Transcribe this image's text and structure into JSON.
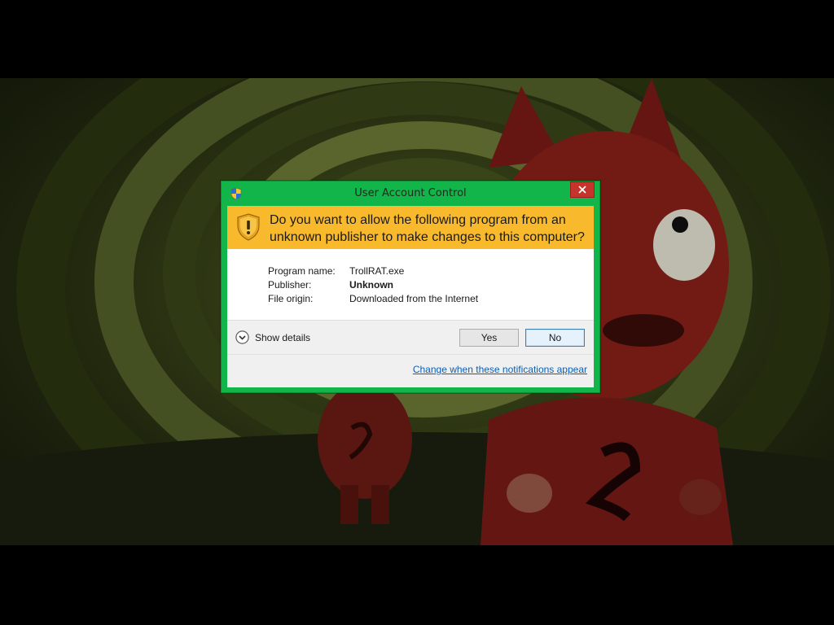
{
  "dialog": {
    "title": "User Account Control",
    "question": "Do you want to allow the following program from an unknown publisher to make changes to this computer?",
    "details": {
      "program_label": "Program name:",
      "program_value": "TrollRAT.exe",
      "publisher_label": "Publisher:",
      "publisher_value": "Unknown",
      "origin_label": "File origin:",
      "origin_value": "Downloaded from the Internet"
    },
    "show_details_label": "Show details",
    "yes_label": "Yes",
    "no_label": "No",
    "settings_link": "Change when these notifications appear"
  },
  "colors": {
    "frame": "#12b549",
    "warning_band": "#f9b92d",
    "close_button": "#c7342c",
    "link": "#0a5fb4"
  },
  "icons": {
    "title": "uac-shield-icon",
    "warning": "warning-shield-icon",
    "close": "close-icon",
    "expand": "chevron-down-icon"
  }
}
